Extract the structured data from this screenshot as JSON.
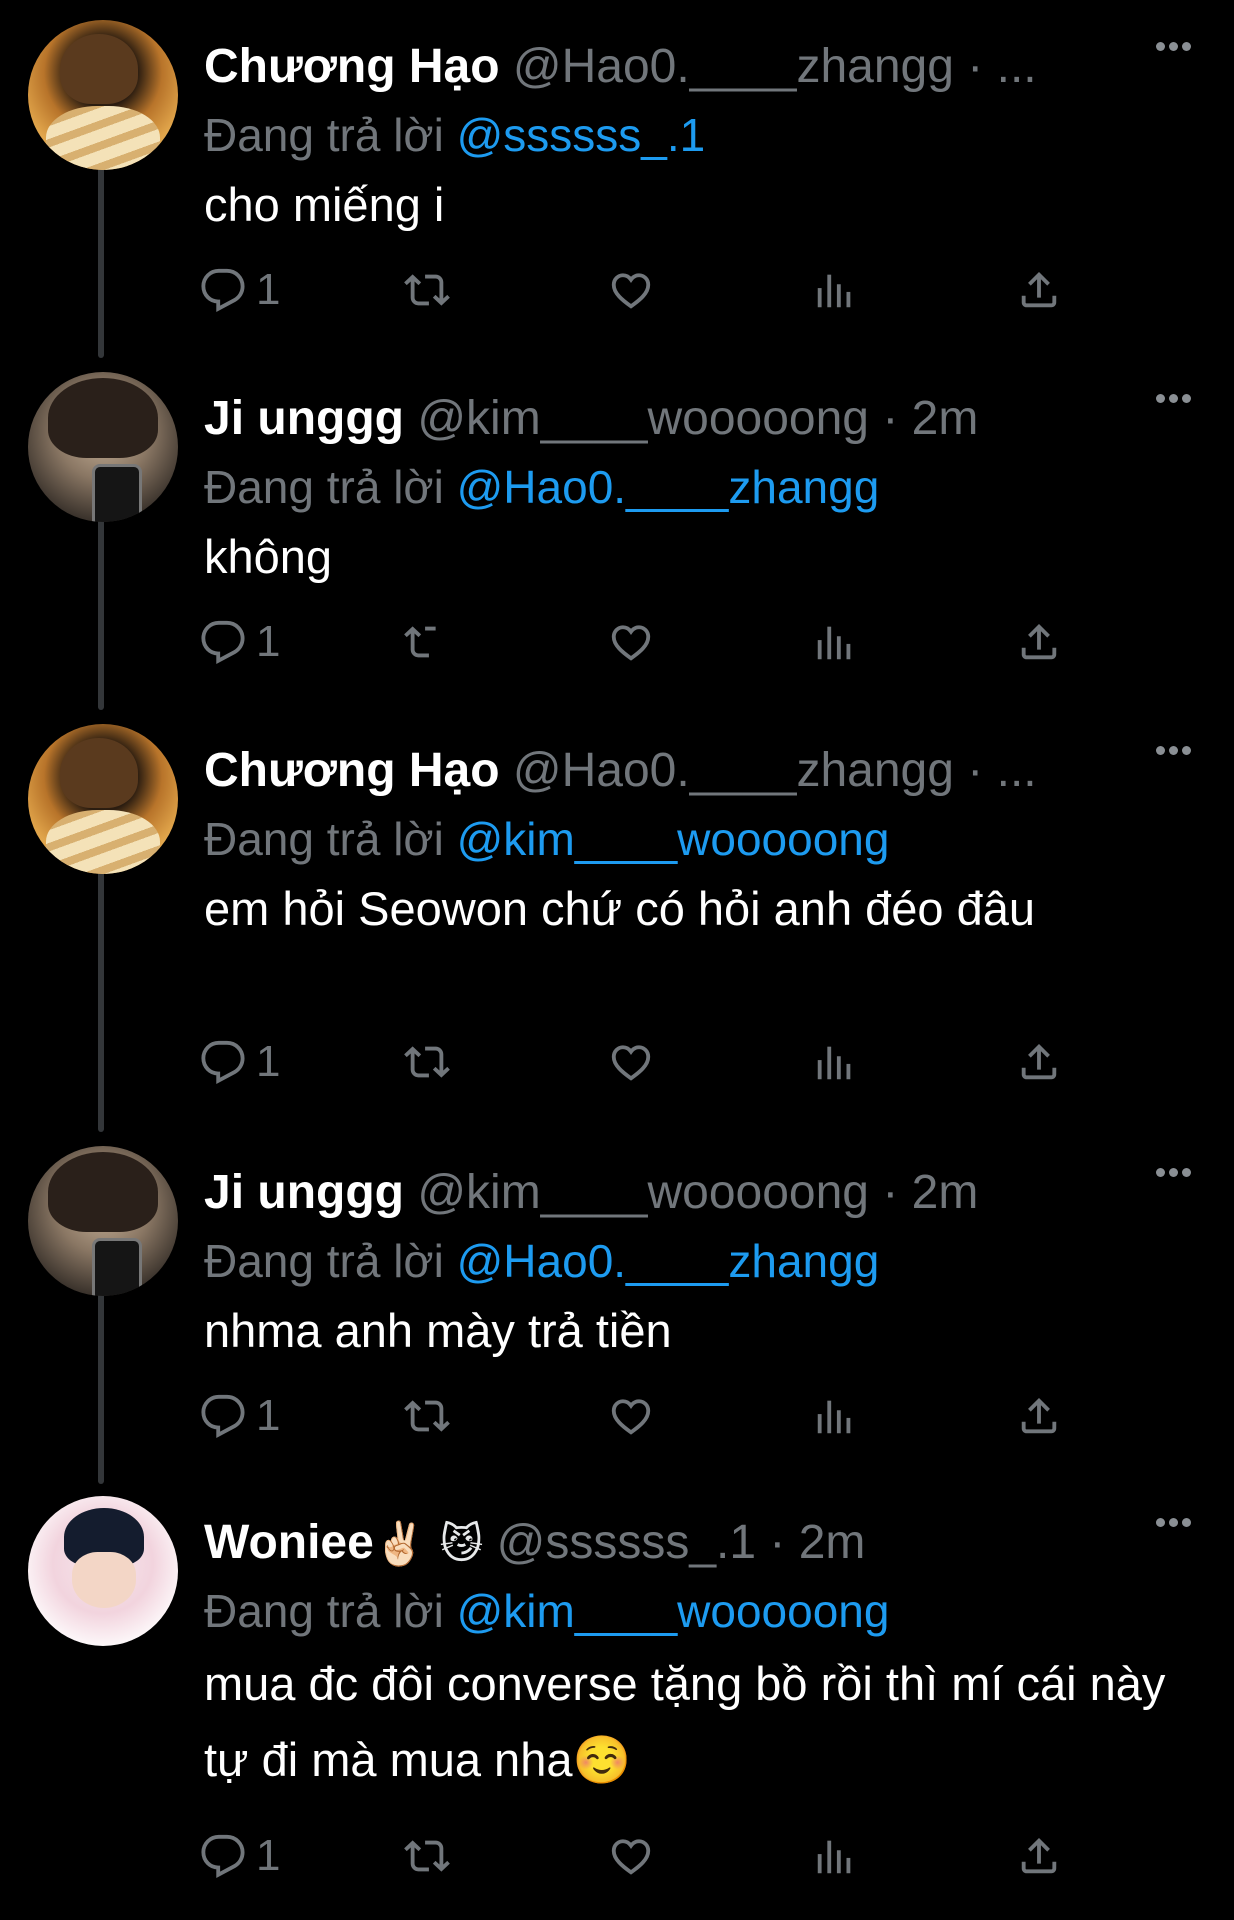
{
  "thread": {
    "reply_prefix": "Đang trả lời",
    "tweets": [
      {
        "display_name": "Chương Hạo",
        "display_emoji": "",
        "handle": "@Hao0.____zhangg",
        "separator": "·",
        "time": "...",
        "reply_to": "@ssssss_.1",
        "text": "cho miếng i",
        "reply_count": "1",
        "avatar": "chuong-hao"
      },
      {
        "display_name": "Ji unggg",
        "display_emoji": "",
        "handle": "@kim____wooooong",
        "separator": "·",
        "time": "2m",
        "reply_to": "@Hao0.____zhangg",
        "text": "không",
        "reply_count": "1",
        "avatar": "ji-unggg"
      },
      {
        "display_name": "Chương Hạo",
        "display_emoji": "",
        "handle": "@Hao0.____zhangg",
        "separator": "·",
        "time": "...",
        "reply_to": "@kim____wooooong",
        "text": "em hỏi Seowon chứ có hỏi anh đéo đâu",
        "reply_count": "1",
        "avatar": "chuong-hao"
      },
      {
        "display_name": "Ji unggg",
        "display_emoji": "",
        "handle": "@kim____wooooong",
        "separator": "·",
        "time": "2m",
        "reply_to": "@Hao0.____zhangg",
        "text": "nhma anh mày trả tiền",
        "reply_count": "1",
        "avatar": "ji-unggg"
      },
      {
        "display_name": "Woniee",
        "display_emoji": "✌🏻 😼",
        "handle": "@ssssss_.1",
        "separator": "·",
        "time": "2m",
        "reply_to": "@kim____wooooong",
        "text": "mua đc đôi converse tặng bồ rồi thì mí cái này tự đi mà mua nha☺️",
        "reply_count": "1",
        "avatar": "woniee"
      }
    ]
  },
  "icons": {
    "reply": "reply-icon",
    "retweet": "retweet-icon",
    "like": "heart-icon",
    "views": "views-icon",
    "share": "share-icon",
    "more": "more-icon"
  },
  "colors": {
    "background": "#000000",
    "name": "#ffffff",
    "secondary": "#71767b",
    "mention": "#1d9bf0",
    "thread_line": "#333639"
  }
}
